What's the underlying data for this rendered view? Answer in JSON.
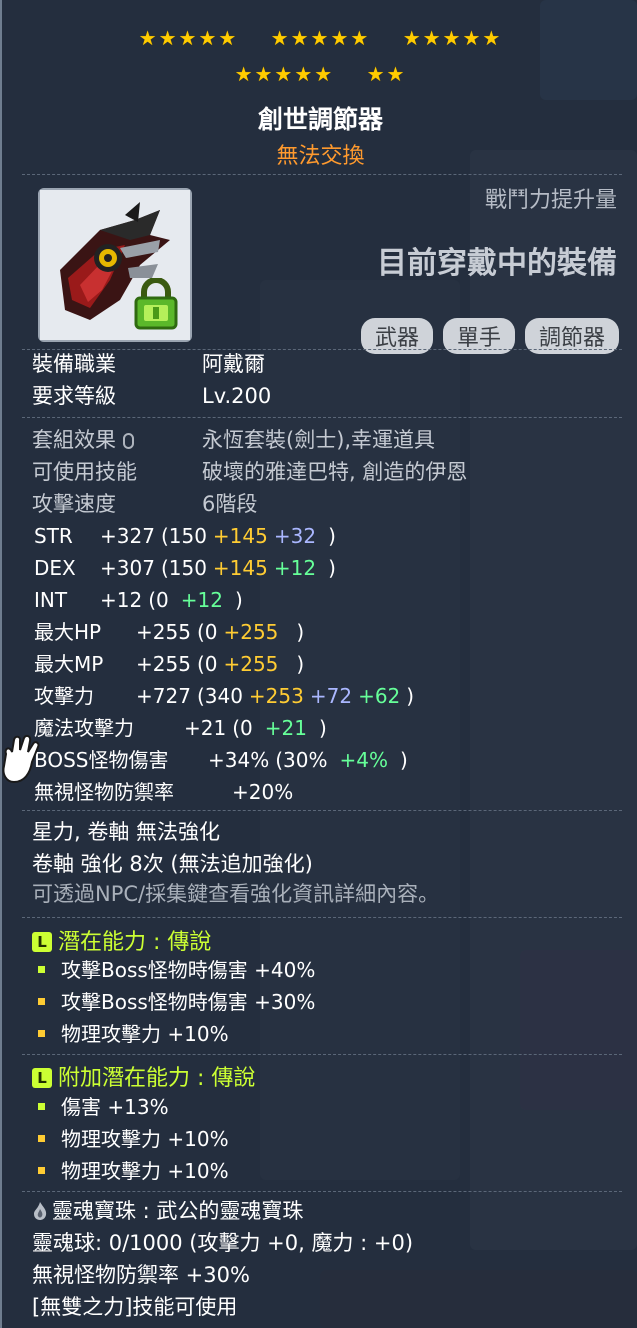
{
  "stars": {
    "groups": [
      "★★★★★",
      "★★★★★",
      "★★★★★",
      "★★★★★",
      "★★"
    ]
  },
  "item": {
    "name": "創世調節器",
    "trade_status": "無法交換",
    "icon": "genesis-controller-icon",
    "lock_icon": "lock-icon"
  },
  "compare": {
    "combat_label": "戰鬥力提升量",
    "wearing_label": "目前穿戴中的裝備"
  },
  "tags": [
    "武器",
    "單手",
    "調節器"
  ],
  "requirements": [
    {
      "label": "裝備職業",
      "value": "阿戴爾"
    },
    {
      "label": "要求等級",
      "value": "Lv.200"
    }
  ],
  "info": [
    {
      "label": "套組效果",
      "value": "永恆套裝(劍士),幸運道具"
    },
    {
      "label": "可使用技能",
      "value": "破壞的雅達巴特, 創造的伊恩"
    },
    {
      "label": "攻擊速度",
      "value": "6階段"
    }
  ],
  "stats": [
    {
      "name": "STR",
      "total": "+327",
      "base": "(150",
      "bonus": "+145",
      "extra": "+32",
      "extra2": "",
      "close": ")"
    },
    {
      "name": "DEX",
      "total": "+307",
      "base": "(150",
      "bonus": "+145",
      "extra": "+12",
      "extra2": "",
      "close": ")"
    },
    {
      "name": "INT",
      "total": "+12",
      "base": "(0",
      "bonus": "",
      "extra": "+12",
      "extra2": "",
      "close": ")"
    },
    {
      "name": "最大HP",
      "total": "+255",
      "base": "(0",
      "bonus": "+255",
      "extra": "",
      "extra2": "",
      "close": ")"
    },
    {
      "name": "最大MP",
      "total": "+255",
      "base": "(0",
      "bonus": "+255",
      "extra": "",
      "extra2": "",
      "close": ")"
    },
    {
      "name": "攻擊力",
      "total": "+727",
      "base": "(340",
      "bonus": "+253",
      "extra": "+72",
      "extra2": "+62",
      "close": ")"
    },
    {
      "name": "魔法攻擊力",
      "total": "+21",
      "base": "(0",
      "bonus": "",
      "extra": "+21",
      "extra2": "",
      "close": ")"
    },
    {
      "name": "BOSS怪物傷害",
      "total": "+34%",
      "base": "(30%",
      "bonus": "",
      "extra": "+4%",
      "extra2": "",
      "close": ")"
    },
    {
      "name": "無視怪物防禦率",
      "total": "+20%",
      "base": "",
      "bonus": "",
      "extra": "",
      "extra2": "",
      "close": ""
    }
  ],
  "enhance": {
    "line1": "星力, 卷軸 無法強化",
    "line2": "卷軸 強化 8次 (無法追加強化)",
    "hint": "可透過NPC/採集鍵查看強化資訊詳細內容。"
  },
  "potential": {
    "badge": "L",
    "title": "潛在能力 : 傳說",
    "lines": [
      "攻擊Boss怪物時傷害 +40%",
      "攻擊Boss怪物時傷害 +30%",
      "物理攻擊力 +10%"
    ]
  },
  "additional": {
    "badge": "L",
    "title": "附加潛在能力 : 傳說",
    "lines": [
      "傷害 +13%",
      "物理攻擊力 +10%",
      "物理攻擊力 +10%"
    ]
  },
  "soul": {
    "title": "靈魂寶珠 : 武公的靈魂寶珠",
    "line1": "靈魂球: 0/1000 (攻擊力 +0, 魔力 : +0)",
    "line2": "無視怪物防禦率 +30%",
    "line3": "[無雙之力]技能可使用"
  },
  "colors": {
    "star": "#ffcc00",
    "trade": "#ff9a2e",
    "bonus_yellow": "#ffcc33",
    "bonus_blue": "#aab7ff",
    "bonus_green": "#66ff99",
    "legendary": "#ccff33"
  }
}
